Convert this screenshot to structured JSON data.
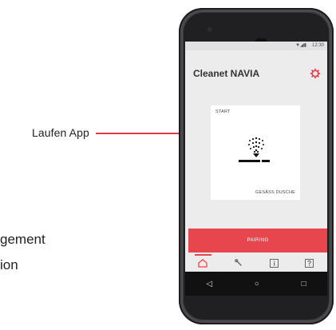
{
  "callout": {
    "label": "Laufen App"
  },
  "side_text": {
    "line1": "gement",
    "line2": "ion"
  },
  "statusbar": {
    "icons": "▼◢▮",
    "time": "12:30"
  },
  "app": {
    "title": "Cleanet NAVIA",
    "settings_icon": "gear-icon",
    "accent": "#e8464f"
  },
  "card": {
    "start_label": "START",
    "mode_label": "GESÄSS DUSCHE"
  },
  "pairing": {
    "label": "PAIRING"
  },
  "tabs": [
    {
      "name": "home",
      "icon": "home-icon"
    },
    {
      "name": "service",
      "icon": "wrench-icon"
    },
    {
      "name": "info",
      "icon": "info-icon"
    },
    {
      "name": "help",
      "icon": "help-icon"
    }
  ],
  "navbar": {
    "back": "◁",
    "home": "○",
    "recent": "□"
  }
}
